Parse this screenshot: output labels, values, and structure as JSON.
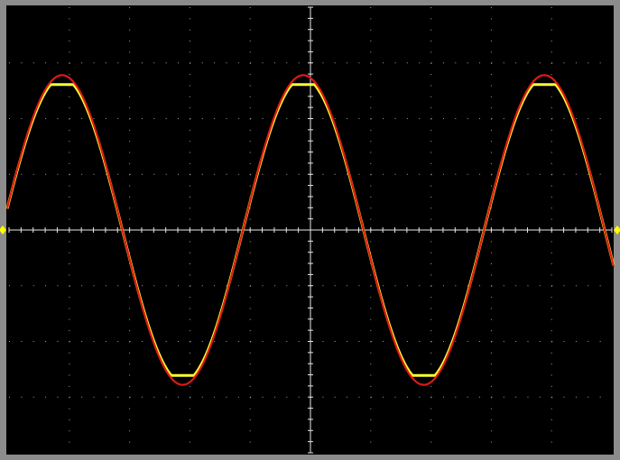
{
  "colors": {
    "screen_background": "#000000",
    "bezel": "#8c8c8c",
    "graticule": "#e8e8e8",
    "trace_measured": "#ffff33",
    "trace_reference": "#dd1a12",
    "marker": "#ffff00"
  },
  "display": {
    "horizontal_divisions": 10,
    "vertical_divisions": 8,
    "minor_ticks_per_division": 5,
    "grid_style": "dotted"
  },
  "traces": [
    {
      "id": "measured",
      "color_key": "trace_measured",
      "shape": "sine",
      "amplitude_div": 2.65,
      "period_div": 4.0,
      "phase_cycles": 0.22,
      "offset_div": 0,
      "clipped_peaks": true
    },
    {
      "id": "reference",
      "color_key": "trace_reference",
      "shape": "sine",
      "amplitude_div": 2.78,
      "period_div": 4.0,
      "phase_cycles": 0.22,
      "offset_div": 0,
      "clipped_peaks": false
    }
  ],
  "markers": [
    {
      "id": "ground-level-left",
      "edge": "left",
      "level_div": 0
    },
    {
      "id": "ground-level-right",
      "edge": "right",
      "level_div": 0
    }
  ]
}
